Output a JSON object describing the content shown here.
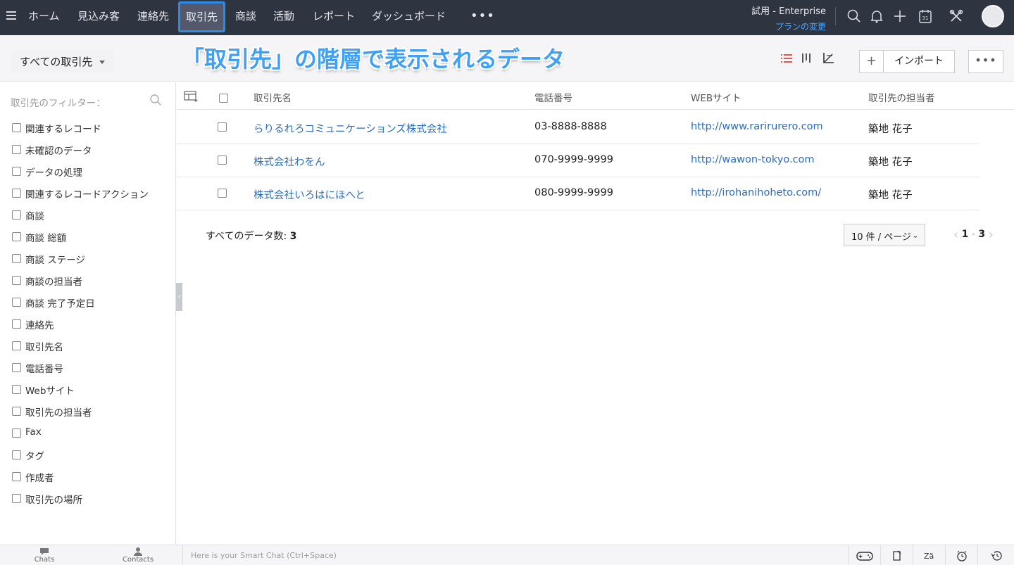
{
  "nav": {
    "items": [
      "ホーム",
      "見込み客",
      "連絡先",
      "取引先",
      "商談",
      "活動",
      "レポート",
      "ダッシュボード"
    ],
    "active": "取引先",
    "more": "•••",
    "trial": "試用 - Enterprise",
    "plan_link": "プランの変更"
  },
  "subheader": {
    "view": "すべての取引先",
    "annotation": "「取引先」の階層で表示されるデータ",
    "add_symbol": "+",
    "import": "インポート",
    "more": "•••"
  },
  "sidebar": {
    "title": "取引先のフィルター：",
    "filters": [
      "関連するレコード",
      "未確認のデータ",
      "データの処理",
      "関連するレコードアクション",
      "商談",
      "商談 総額",
      "商談 ステージ",
      "商談の担当者",
      "商談 完了予定日",
      "連絡先",
      "取引先名",
      "電話番号",
      "Webサイト",
      "取引先の担当者",
      "Fax",
      "タグ",
      "作成者",
      "取引先の場所"
    ]
  },
  "table": {
    "columns": [
      "取引先名",
      "電話番号",
      "WEBサイト",
      "取引先の担当者"
    ],
    "rows": [
      {
        "name": "らりるれろコミュニケーションズ株式会社",
        "phone": "03-8888-8888",
        "website": "http://www.rarirurero.com",
        "owner": "築地 花子"
      },
      {
        "name": "株式会社わをん",
        "phone": "070-9999-9999",
        "website": "http://wawon-tokyo.com",
        "owner": "築地 花子"
      },
      {
        "name": "株式会社いろはにほへと",
        "phone": "080-9999-9999",
        "website": "http://irohanihoheto.com/",
        "owner": "築地 花子"
      }
    ]
  },
  "footer": {
    "total_label": "すべてのデータ数:",
    "total_count": "3",
    "per_page": "10 件 / ページ",
    "page_start": "1",
    "page_sep": "-",
    "page_end": "3"
  },
  "bottombar": {
    "chats": "Chats",
    "contacts": "Contacts",
    "smart_chat_placeholder": "Here is your Smart Chat (Ctrl+Space)"
  },
  "colors": {
    "nav_bg": "#2f3441",
    "active_border": "#2b8cf0",
    "link": "#2a6cc4",
    "annotation": "#3fa0f5"
  }
}
